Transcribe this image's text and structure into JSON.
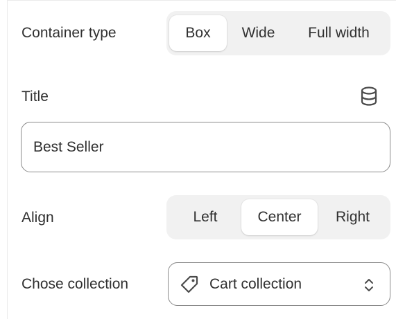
{
  "container_type": {
    "label": "Container type",
    "options": [
      "Box",
      "Wide",
      "Full width"
    ],
    "selected": "Box"
  },
  "title_field": {
    "label": "Title",
    "value": "Best Seller",
    "dynamic_source_icon": "database-icon"
  },
  "align": {
    "label": "Align",
    "options": [
      "Left",
      "Center",
      "Right"
    ],
    "selected": "Center"
  },
  "collection": {
    "label": "Chose collection",
    "value": "Cart collection",
    "leading_icon": "tag-icon",
    "trailing_icon": "select-chevrons-icon"
  },
  "colors": {
    "segment_track": "#f1f1f1",
    "segment_active": "#ffffff",
    "field_border": "#8a8a8a",
    "text": "#303030"
  }
}
